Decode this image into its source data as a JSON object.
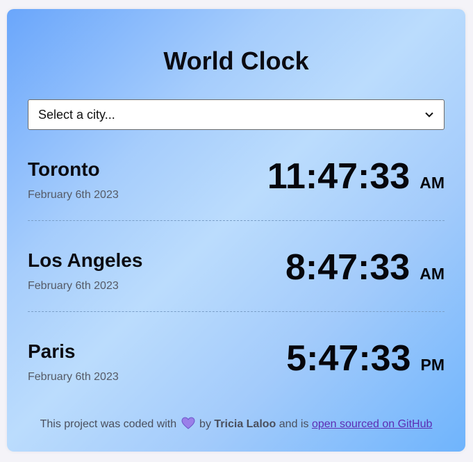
{
  "title": "World Clock",
  "city_select": {
    "selected": "Select a city..."
  },
  "cities": [
    {
      "name": "Toronto",
      "date": "February 6th 2023",
      "time": "11:47:33",
      "period": "AM"
    },
    {
      "name": "Los Angeles",
      "date": "February 6th 2023",
      "time": "8:47:33",
      "period": "AM"
    },
    {
      "name": "Paris",
      "date": "February 6th 2023",
      "time": "5:47:33",
      "period": "PM"
    }
  ],
  "footer": {
    "prefix": "This project was coded with",
    "heart_icon": "heart-icon",
    "by": "by",
    "author": "Tricia Laloo",
    "middle": "and is",
    "link_text": "open sourced on GitHub"
  },
  "colors": {
    "gradient_dark": "#6aa6fb",
    "gradient_light": "#bbdcfd",
    "heart": "#9a7fe8",
    "link": "#5b2db4"
  }
}
